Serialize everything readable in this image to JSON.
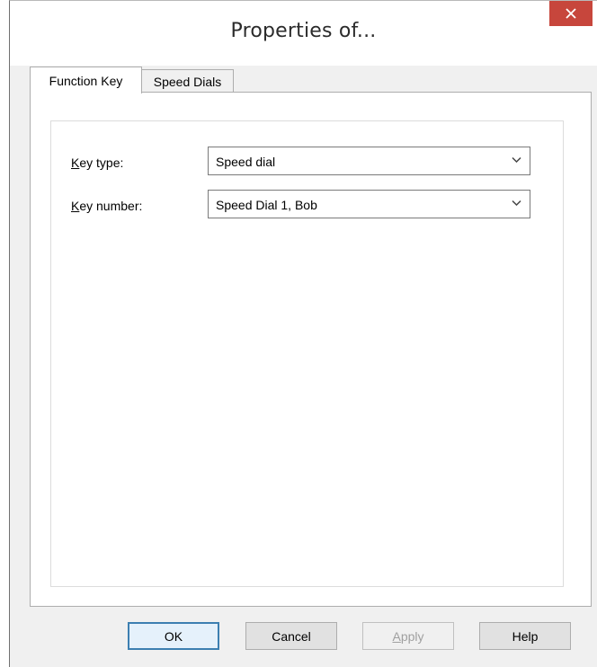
{
  "window": {
    "title": "Properties of..."
  },
  "tabs": [
    {
      "label": "Function Key",
      "selected": true
    },
    {
      "label": "Speed Dials",
      "selected": false
    }
  ],
  "form": {
    "key_type": {
      "label": "Key type:",
      "mnemonic": "K",
      "value": "Speed dial"
    },
    "key_number": {
      "label": "Key number:",
      "mnemonic": "K",
      "value": "Speed Dial 1, Bob"
    }
  },
  "buttons": [
    {
      "label": "OK",
      "default": true,
      "enabled": true
    },
    {
      "label": "Cancel",
      "enabled": true
    },
    {
      "label": "Apply",
      "enabled": false
    },
    {
      "label": "Help",
      "enabled": true
    }
  ],
  "icons": {
    "close": "close-icon",
    "dropdown": "chevron-down-icon"
  },
  "colors": {
    "close_button": "#c7463c",
    "default_button_border": "#3c7fb1"
  }
}
